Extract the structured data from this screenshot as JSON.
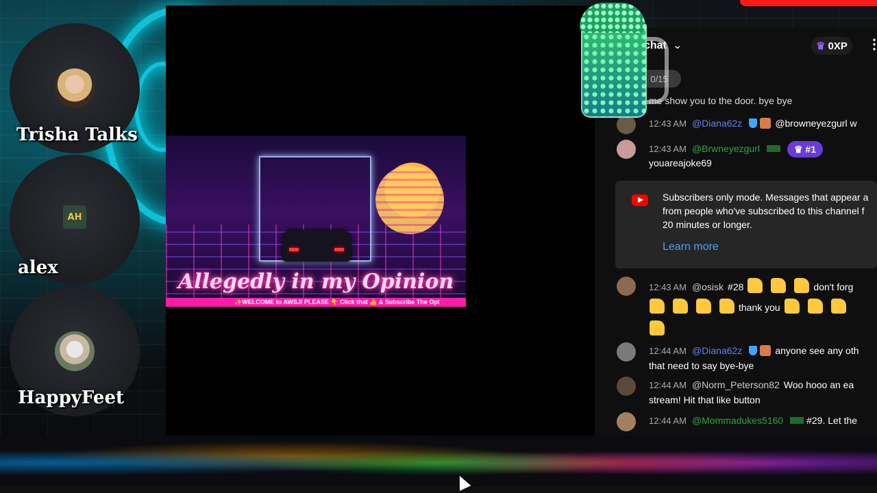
{
  "participants": [
    {
      "name": "Trisha Talks"
    },
    {
      "name": "alex",
      "avatar_text": "AH"
    },
    {
      "name": "HappyFeet"
    }
  ],
  "banner": {
    "title": "Allegedly in my Opinion",
    "ticker": "✨WELCOME to AWSJI PLEASE 👇 Click that 👍 & Subscribe   The Opi"
  },
  "chat": {
    "title": "chat",
    "xp": "0XP",
    "counter": "0/15",
    "partial_top": "me show you to the door. bye bye",
    "messages": [
      {
        "time": "12:43 AM",
        "user": "@Diana62z",
        "text": "@browneyezgurl w",
        "role": "mod"
      },
      {
        "time": "12:43 AM",
        "user": "@Brwneyezgurl",
        "rank": "#1",
        "line2": "youareajoke69",
        "role": "member"
      },
      {
        "time": "12:43 AM",
        "user": "@osisk",
        "text": "#28",
        "trail": "don't forg",
        "line2_trail": "thank you",
        "role": "plain"
      },
      {
        "time": "12:44 AM",
        "user": "@Diana62z",
        "text": "anyone see any oth",
        "line2": "that need to say bye-bye",
        "role": "mod"
      },
      {
        "time": "12:44 AM",
        "user": "@Norm_Peterson82",
        "text": "Woo hooo an ea",
        "line2": "stream! Hit that like button",
        "role": "plain"
      },
      {
        "time": "12:44 AM",
        "user": "@Mommadukes5160",
        "text": "#29. Let the",
        "role": "member"
      }
    ],
    "notice": {
      "line1": "Subscribers only mode. Messages that appear a",
      "line2": "from people who've subscribed to this channel f",
      "line3": "20 minutes or longer.",
      "link": "Learn more"
    }
  },
  "colors": {
    "accent_pink": "#ff1aa8",
    "link_blue": "#3ea6ff",
    "member_green": "#2ba640",
    "rank_purple": "#6a3bd8"
  },
  "icons": [
    "chevron-down-icon",
    "crown-icon",
    "more-vert-icon",
    "youtube-icon",
    "thumbs-up-icon",
    "verified-icon",
    "cursor-icon"
  ]
}
